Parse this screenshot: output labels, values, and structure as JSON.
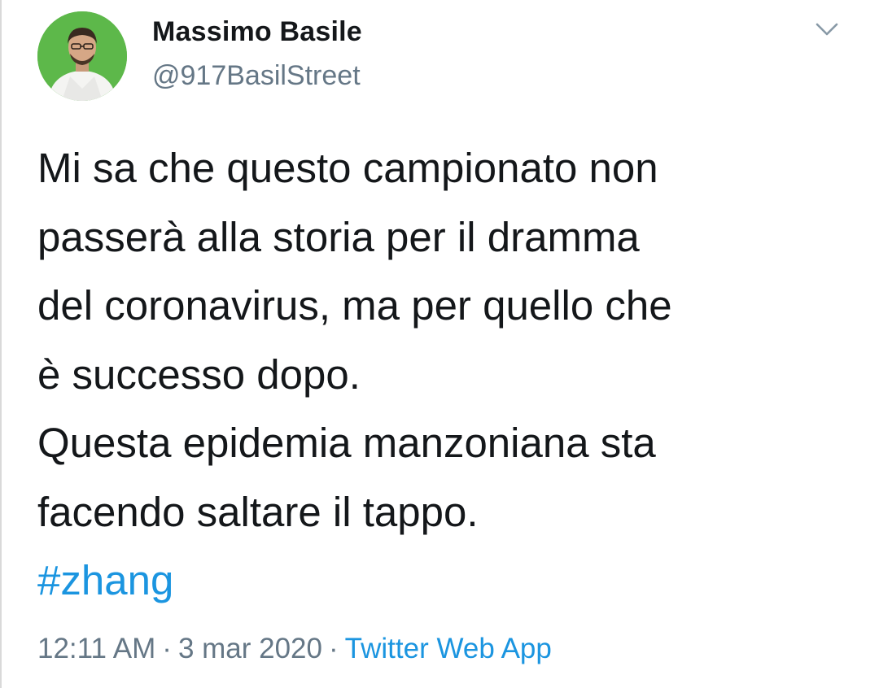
{
  "author": {
    "name": "Massimo Basile",
    "handle": "@917BasilStreet",
    "avatar_background": "#5db84a"
  },
  "menu": {
    "icon": "chevron-down-icon"
  },
  "tweet": {
    "lines": [
      "Mi sa che questo campionato non",
      "passerà alla storia per il dramma",
      "del coronavirus, ma per quello che",
      "è successo dopo.",
      "Questa epidemia manzoniana sta",
      "facendo saltare il tappo."
    ],
    "hashtag": "#zhang"
  },
  "meta": {
    "time": "12:11 AM",
    "separator": "·",
    "date": "3 mar 2020",
    "source": "Twitter Web App"
  },
  "colors": {
    "link": "#1b95e0",
    "secondary_text": "#657786",
    "primary_text": "#14171a"
  }
}
